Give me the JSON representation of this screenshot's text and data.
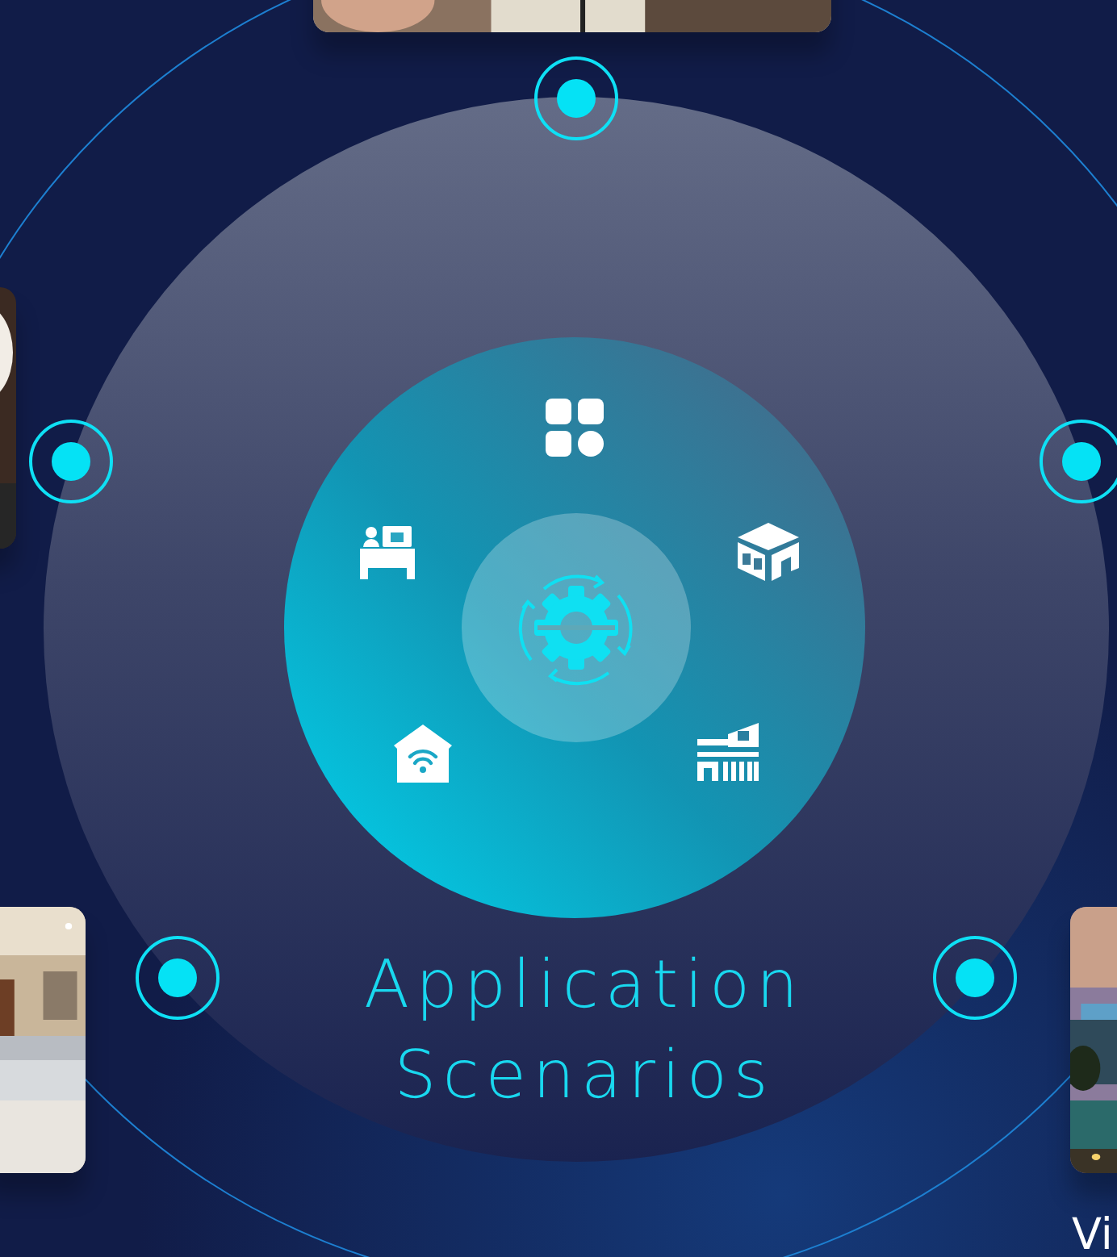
{
  "hub": {
    "title": "Application Scenarios"
  },
  "photo_caption": {
    "text": "Vi"
  }
}
